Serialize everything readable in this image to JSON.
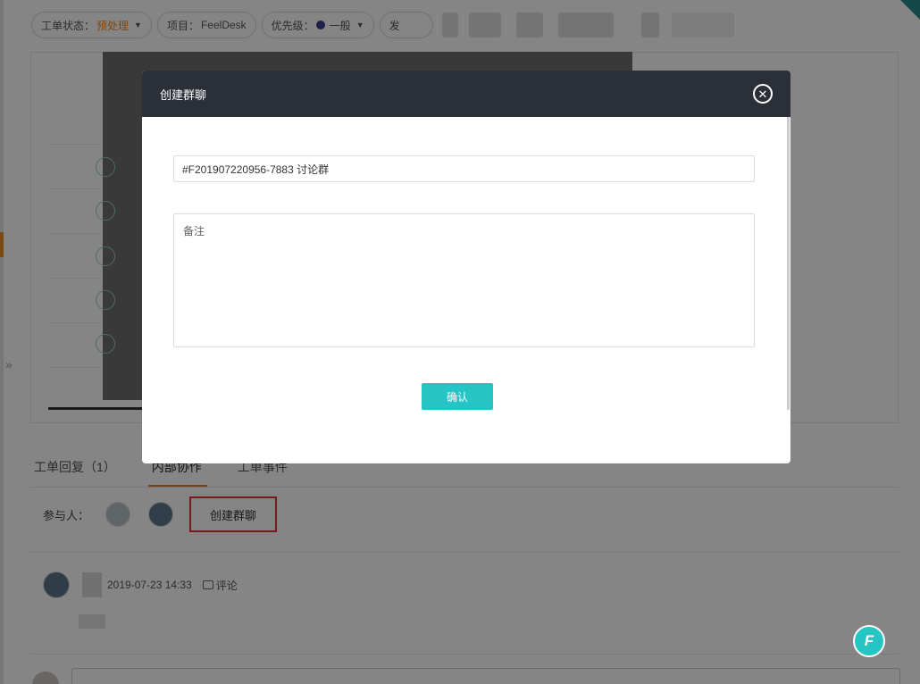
{
  "filter_bar": {
    "status": {
      "label": "工单状态：",
      "value": "预处理"
    },
    "project": {
      "label": "项目：",
      "value": "FeelDesk"
    },
    "priority": {
      "label": "优先级：",
      "value": "一般",
      "dot_color": "#3d3d8f"
    },
    "partial_pill": "发"
  },
  "tabs": [
    {
      "label": "工单回复（1）"
    },
    {
      "label": "内部协作"
    },
    {
      "label": "工单事件"
    }
  ],
  "participants": {
    "label": "参与人：",
    "create_group_label": "创建群聊"
  },
  "comment": {
    "timestamp": "2019-07-23 14:33",
    "action_label": "评论"
  },
  "fab": {
    "label": "F"
  },
  "modal": {
    "title": "创建群聊",
    "group_name_value": "#F201907220956-7883 讨论群",
    "note_placeholder": "备注",
    "confirm_label": "确认"
  },
  "colors": {
    "accent": "#27c4c5",
    "status_accent": "#f08a24",
    "modal_header": "#2b2f37",
    "highlight_border": "#e03131"
  }
}
